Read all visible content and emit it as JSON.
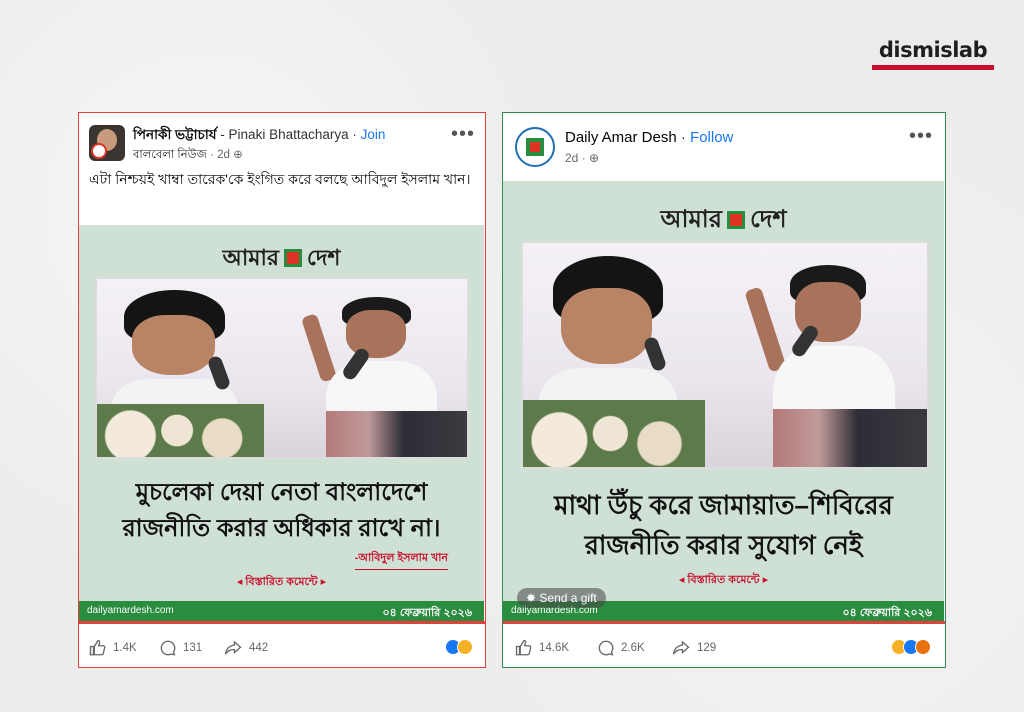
{
  "brand": {
    "name": "dismislab"
  },
  "posts": [
    {
      "author_bn": "পিনাকী ভট্টাচার্য",
      "author_en": "Pinaki Bhattacharya",
      "action": "Join",
      "source": "বালবেলা নিউজ",
      "time": "2d",
      "caption": "এটা নিশ্চয়ই খাম্বা তারেক'কে ইংগিত করে বলছে আবিদুল ইসলাম খান।",
      "card": {
        "masthead_left": "আমার",
        "masthead_right": "দেশ",
        "headline": "মুচলেকা দেয়া নেতা বাংলাদেশে রাজনীতি করার অধিকার রাখে না।",
        "attribution": "-আবিদুল ইসলাম খান",
        "more": "◂ বিস্তারিত কমেন্টে ▸",
        "site": "dailyamardesh.com",
        "date": "০৪ ফেব্রুয়ারি ২০২৬"
      },
      "stats": {
        "likes": "1.4K",
        "comments": "131",
        "shares": "442"
      }
    },
    {
      "author_en": "Daily Amar Desh",
      "action": "Follow",
      "time": "2d",
      "card": {
        "masthead_left": "আমার",
        "masthead_right": "দেশ",
        "headline": "মাথা উঁচু করে জামায়াত–শিবিরের রাজনীতি করার সুযোগ নেই",
        "more": "◂ বিস্তারিত কমেন্টে ▸",
        "site": "dailyamardesh.com",
        "date": "০৪ ফেব্রুয়ারি ২০২৬",
        "gift": "Send a gift"
      },
      "stats": {
        "likes": "14.6K",
        "comments": "2.6K",
        "shares": "129"
      }
    }
  ],
  "colors": {
    "accent_red": "#c8102e",
    "fb_blue": "#1877f2",
    "card_green": "#2a8c3e"
  }
}
